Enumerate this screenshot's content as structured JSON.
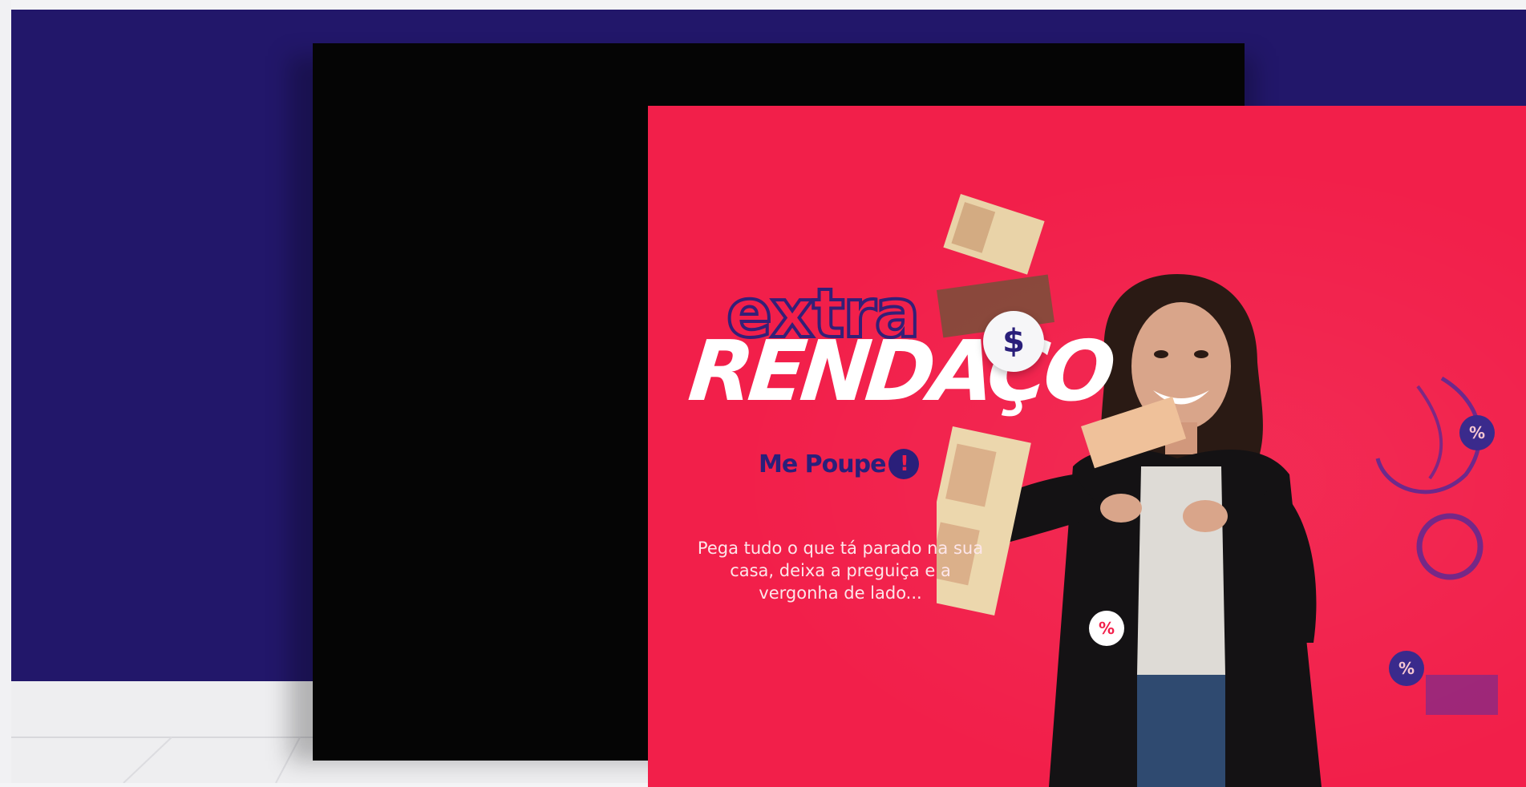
{
  "poster": {
    "headline_top": "extra",
    "headline_main": "RENDAÇO",
    "brand_name": "Me Poupe",
    "brand_mark": "!",
    "tagline": "Pega tudo o que tá parado na sua casa, deixa a preguiça e a vergonha de lado...",
    "coin_symbol": "$",
    "badge_symbol": "%"
  },
  "colors": {
    "wall": "#22176a",
    "poster_background": "#f21f4a",
    "accent_navy": "#2a1f7a",
    "frame": "#050505",
    "floor": "#eeeef0"
  },
  "icons": [
    "dollar-coin-icon",
    "percent-badge-icon",
    "money-bills-illustration"
  ]
}
